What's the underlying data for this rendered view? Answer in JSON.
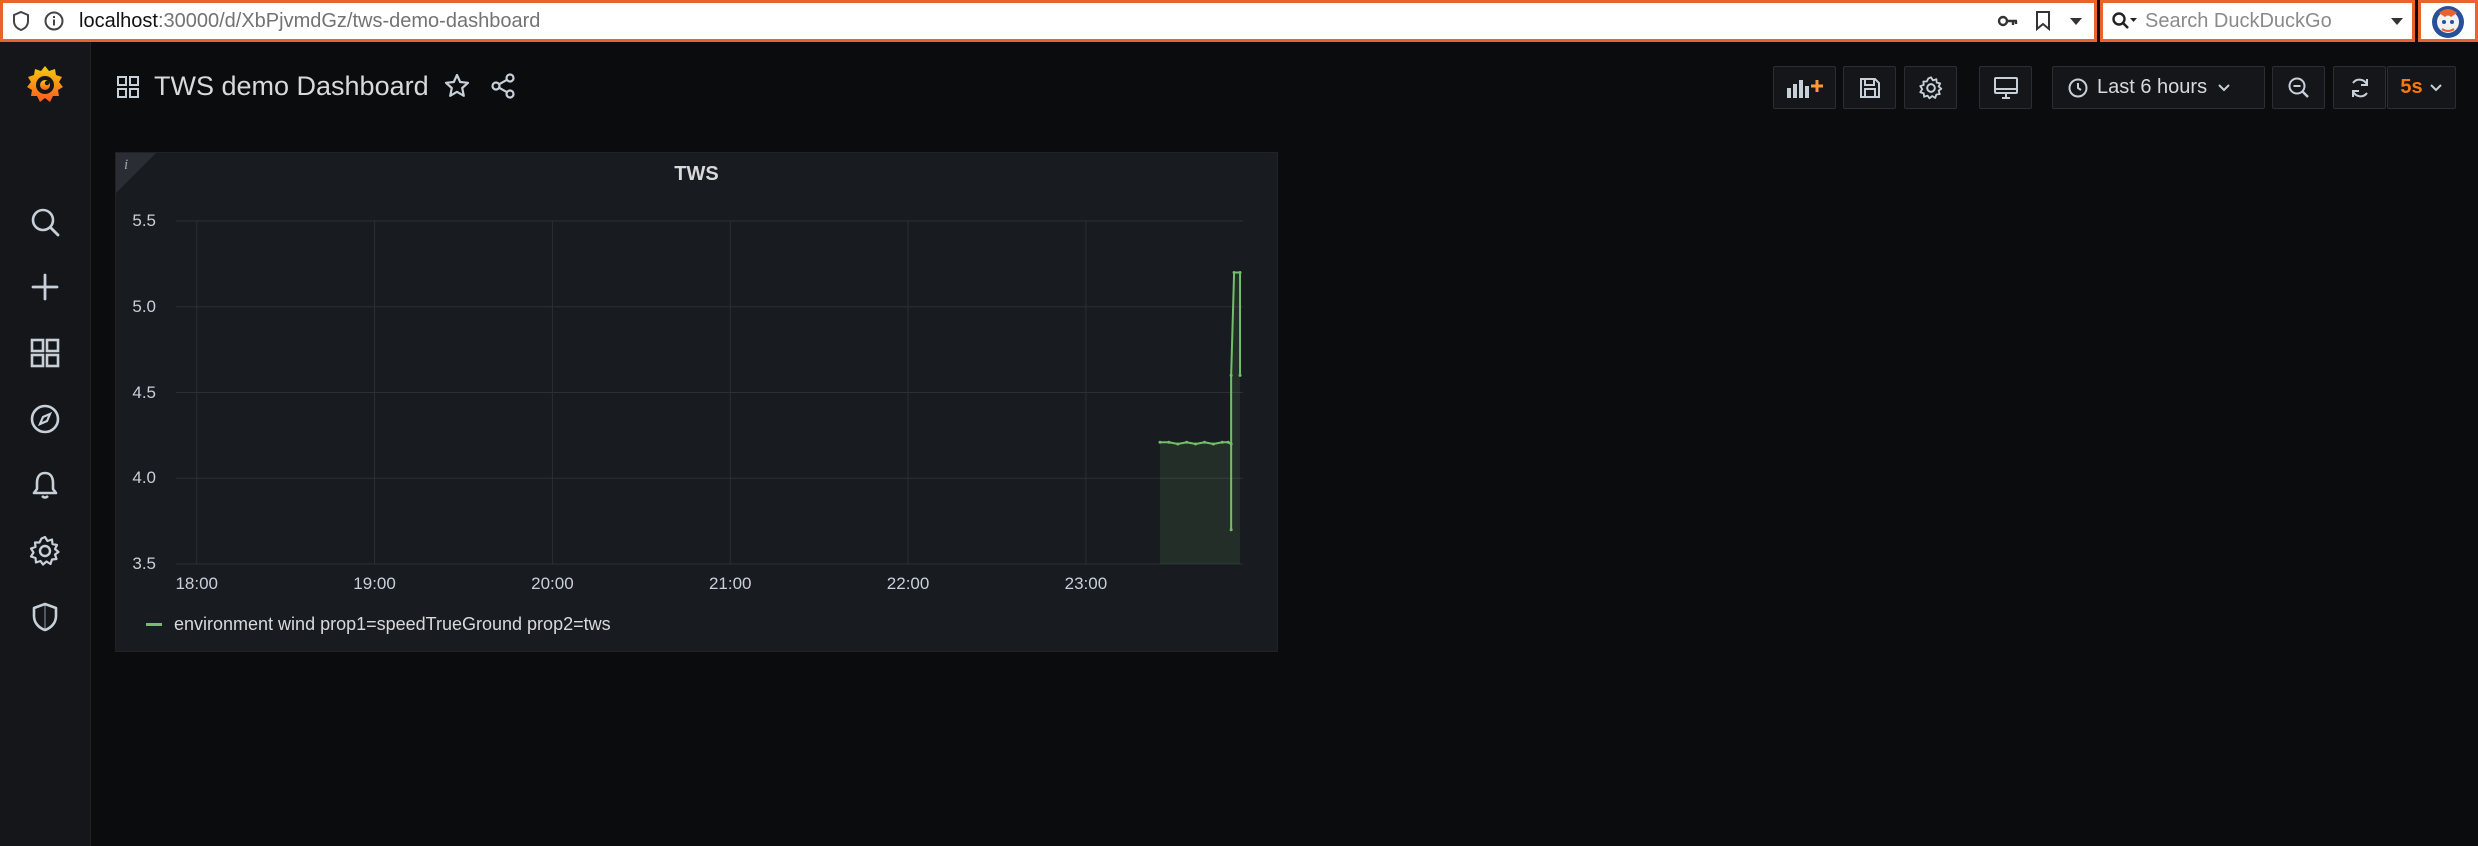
{
  "browser": {
    "url_host": "localhost",
    "url_rest": ":30000/d/XbPjvmdGz/tws-demo-dashboard",
    "search_placeholder": "Search DuckDuckGo"
  },
  "dashboard": {
    "title": "TWS demo Dashboard",
    "time_range": "Last 6 hours",
    "refresh_interval": "5s"
  },
  "sidebar": {
    "items": [
      {
        "name": "search",
        "icon": "search-icon"
      },
      {
        "name": "create",
        "icon": "plus-icon"
      },
      {
        "name": "dashboards",
        "icon": "apps-icon"
      },
      {
        "name": "explore",
        "icon": "compass-icon"
      },
      {
        "name": "alerting",
        "icon": "bell-icon"
      },
      {
        "name": "configuration",
        "icon": "gear-icon"
      },
      {
        "name": "server-admin",
        "icon": "shield-icon"
      }
    ]
  },
  "toolbar": {
    "buttons": [
      "add-panel-icon",
      "save-icon",
      "gear-icon",
      "tv-icon",
      "clock-icon",
      "zoom-out-icon",
      "refresh-icon"
    ]
  },
  "panel": {
    "title": "TWS",
    "info_marker": "i",
    "legend": [
      {
        "label": "environment wind prop1=speedTrueGround prop2=tws",
        "color": "#73bf69"
      }
    ]
  },
  "chart_data": {
    "type": "line",
    "title": "TWS",
    "xlabel": "",
    "ylabel": "",
    "x_ticks": [
      "18:00",
      "19:00",
      "20:00",
      "21:00",
      "22:00",
      "23:00"
    ],
    "y_ticks": [
      "3.5",
      "4.0",
      "4.5",
      "5.0",
      "5.5"
    ],
    "ylim": [
      3.5,
      5.5
    ],
    "xlim": [
      "17:53",
      "23:53"
    ],
    "grid": true,
    "legend_position": "bottom-left",
    "fill": true,
    "series": [
      {
        "name": "environment wind prop1=speedTrueGround prop2=tws",
        "color": "#73bf69",
        "points": [
          [
            "23:25",
            4.21
          ],
          [
            "23:28",
            4.21
          ],
          [
            "23:31",
            4.2
          ],
          [
            "23:34",
            4.21
          ],
          [
            "23:37",
            4.2
          ],
          [
            "23:40",
            4.21
          ],
          [
            "23:43",
            4.2
          ],
          [
            "23:46",
            4.21
          ],
          [
            "23:48",
            4.21
          ],
          [
            "23:49",
            4.2
          ],
          [
            "23:49",
            3.7
          ],
          [
            "23:49",
            4.6
          ],
          [
            "23:50",
            5.2
          ],
          [
            "23:52",
            5.2
          ],
          [
            "23:52",
            4.6
          ]
        ]
      }
    ]
  }
}
